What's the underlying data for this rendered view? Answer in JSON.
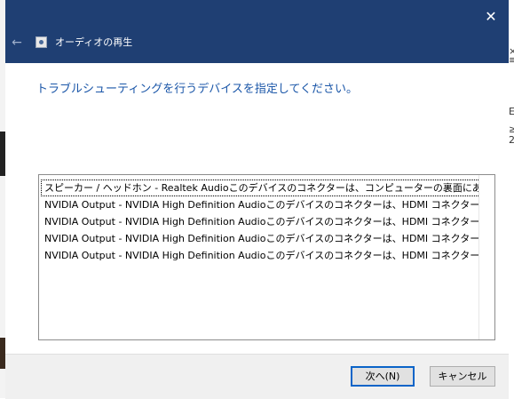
{
  "window": {
    "title": "オーディオの再生",
    "heading": "トラブルシューティングを行うデバイスを指定してください。",
    "close_icon": "close-icon",
    "back_icon": "back-arrow-icon"
  },
  "devices": [
    {
      "label": "スピーカー / ヘッドホン - Realtek Audioこのデバイスのコネクターは、コンピューターの裏面にあり...",
      "selected": true
    },
    {
      "label": "NVIDIA Output - NVIDIA High Definition Audioこのデバイスのコネクターは、HDMI コネクター..."
    },
    {
      "label": "NVIDIA Output - NVIDIA High Definition Audioこのデバイスのコネクターは、HDMI コネクター..."
    },
    {
      "label": "NVIDIA Output - NVIDIA High Definition Audioこのデバイスのコネクターは、HDMI コネクター..."
    },
    {
      "label": "NVIDIA Output - NVIDIA High Definition Audioこのデバイスのコネクターは、HDMI コネクター..."
    }
  ],
  "buttons": {
    "next": "次へ(N)",
    "cancel": "キャンセル"
  },
  "background": {
    "right_glyphs": [
      "×",
      "≡",
      "E",
      "≥",
      "2"
    ]
  },
  "colors": {
    "titlebar": "#1f3f73",
    "heading": "#1a56a8",
    "primary_border": "#0a64c8"
  }
}
